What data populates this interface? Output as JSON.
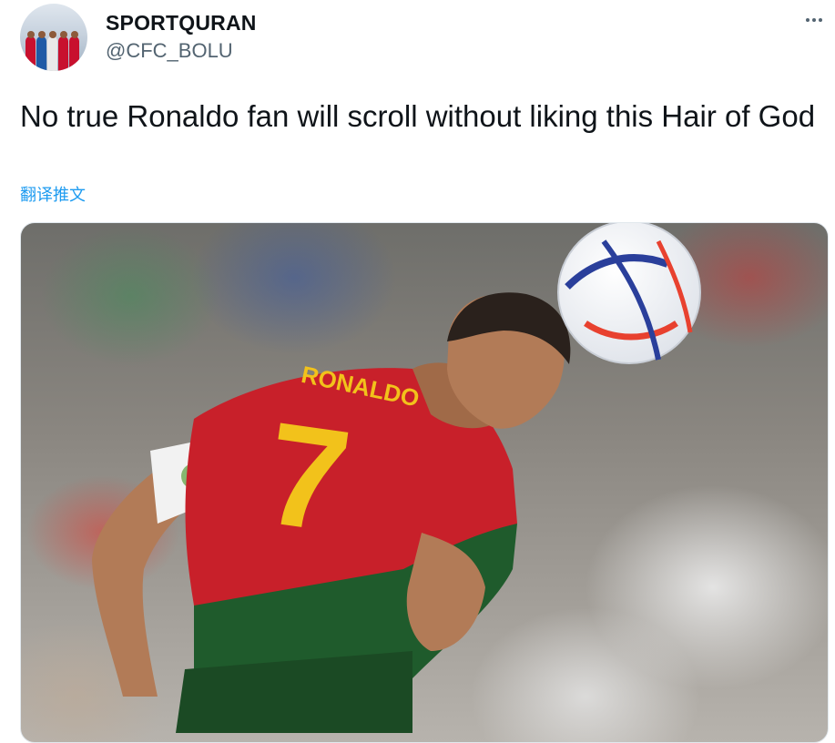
{
  "tweet": {
    "display_name": "SPORTQURAN",
    "handle": "@CFC_BOLU",
    "text": "No true Ronaldo fan will scroll without liking this Hair of God",
    "translate_label": "翻译推文",
    "more_icon": "more-horizontal-icon"
  },
  "media": {
    "jersey_name": "RONALDO",
    "jersey_number": "7"
  },
  "colors": {
    "link": "#1d9bf0",
    "text": "#0f1419",
    "secondary": "#536471"
  }
}
